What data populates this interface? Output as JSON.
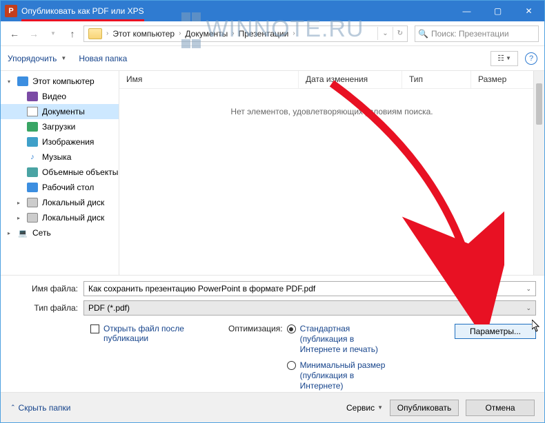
{
  "title": "Опубликовать как PDF или XPS",
  "watermark": "WINNOTE.RU",
  "nav": {
    "crumbs": [
      "Этот компьютер",
      "Документы",
      "Презентации"
    ],
    "search_placeholder": "Поиск: Презентации"
  },
  "toolbar": {
    "organize": "Упорядочить",
    "new_folder": "Новая папка",
    "view_icon": "☷"
  },
  "columns": {
    "name": "Имя",
    "modified": "Дата изменения",
    "type": "Тип",
    "size": "Размер"
  },
  "empty_message": "Нет элементов, удовлетворяющих условиям поиска.",
  "tree": [
    {
      "label": "Этот компьютер",
      "icon": "pc",
      "style": "expanded"
    },
    {
      "label": "Видео",
      "icon": "video",
      "style": "leaf sub"
    },
    {
      "label": "Документы",
      "icon": "doc",
      "style": "leaf sub",
      "selected": true
    },
    {
      "label": "Загрузки",
      "icon": "down",
      "style": "leaf sub"
    },
    {
      "label": "Изображения",
      "icon": "img",
      "style": "leaf sub"
    },
    {
      "label": "Музыка",
      "icon": "music",
      "style": "leaf sub"
    },
    {
      "label": "Объемные объекты",
      "icon": "3d",
      "style": "leaf sub"
    },
    {
      "label": "Рабочий стол",
      "icon": "desk",
      "style": "leaf sub"
    },
    {
      "label": "Локальный диск",
      "icon": "disk",
      "style": "collapsed sub"
    },
    {
      "label": "Локальный диск",
      "icon": "disk",
      "style": "collapsed sub"
    },
    {
      "label": "Сеть",
      "icon": "net",
      "style": "collapsed"
    }
  ],
  "form": {
    "filename_label": "Имя файла:",
    "filename_value": "Как сохранить презентацию PowerPoint в формате PDF.pdf",
    "type_label": "Тип файла:",
    "type_value": "PDF (*.pdf)",
    "open_after": "Открыть файл после публикации",
    "optimization_label": "Оптимизация:",
    "opt_standard": "Стандартная (публикация в Интернете и печать)",
    "opt_minimal": "Минимальный размер (публикация в Интернете)",
    "params_button": "Параметры..."
  },
  "footer": {
    "hide": "Скрыть папки",
    "tools": "Сервис",
    "publish": "Опубликовать",
    "cancel": "Отмена"
  }
}
